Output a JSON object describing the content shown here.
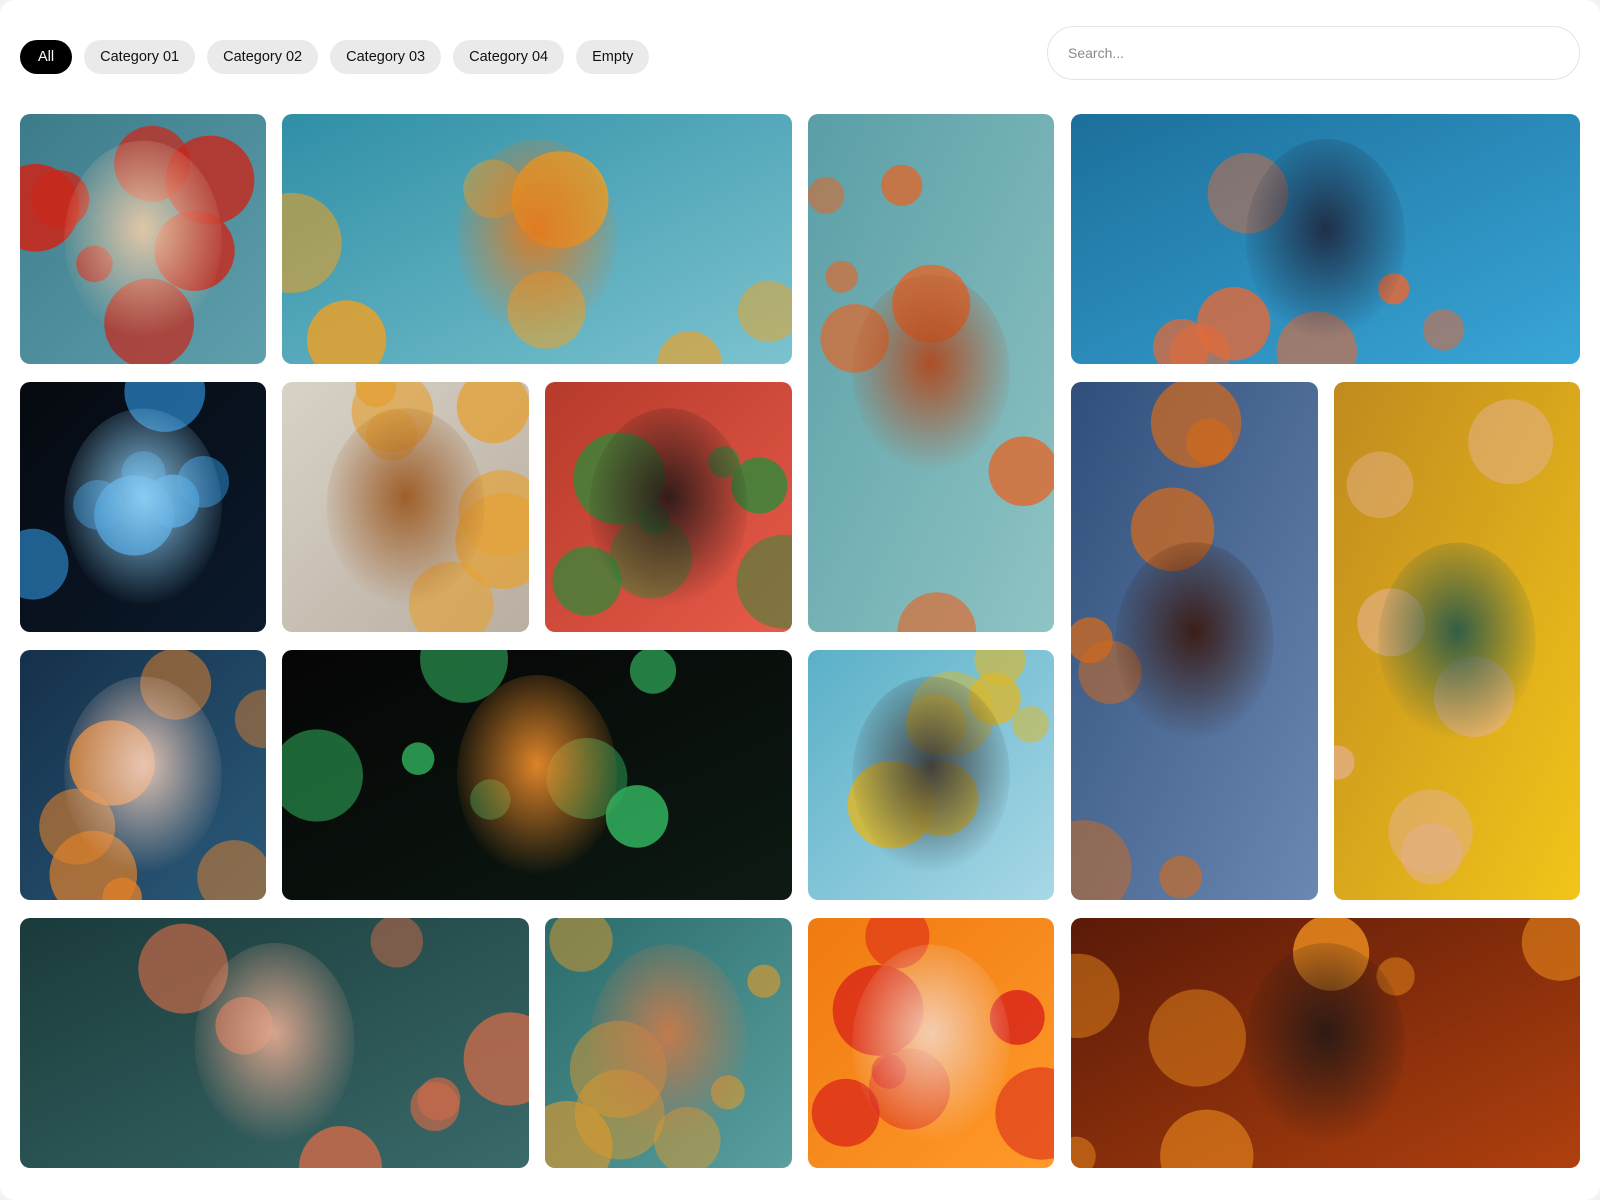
{
  "filters": {
    "items": [
      {
        "label": "All",
        "active": true
      },
      {
        "label": "Category 01",
        "active": false
      },
      {
        "label": "Category 02",
        "active": false
      },
      {
        "label": "Category 03",
        "active": false
      },
      {
        "label": "Category 04",
        "active": false
      },
      {
        "label": "Empty",
        "active": false
      }
    ]
  },
  "search": {
    "placeholder": "Search...",
    "value": ""
  },
  "gallery": {
    "images": [
      {
        "name": "portrait-red-cap-fish",
        "palette": [
          "#3d7b8a",
          "#5fa0ad",
          "#c8281c",
          "#e8c9a8"
        ]
      },
      {
        "name": "girl-underwater-oranges",
        "palette": [
          "#2f8fa6",
          "#7cc3cf",
          "#f0a020",
          "#e07a20"
        ]
      },
      {
        "name": "folk-doll-flower-crown",
        "palette": [
          "#5a9ea6",
          "#8fc4c4",
          "#e0672a",
          "#b04a20"
        ]
      },
      {
        "name": "vr-headset-explosion",
        "palette": [
          "#1c6f9a",
          "#39a6d8",
          "#e06a3a",
          "#1e2b44"
        ]
      },
      {
        "name": "cyber-girl-blue-glow",
        "palette": [
          "#06090f",
          "#0b1a2c",
          "#2a7fbf",
          "#8fd0f5"
        ]
      },
      {
        "name": "steampunk-goggles-pilot",
        "palette": [
          "#d8d2c8",
          "#b9aea0",
          "#e3a23a",
          "#9c5a22"
        ]
      },
      {
        "name": "woman-with-parrot",
        "palette": [
          "#b63a2a",
          "#e85b4a",
          "#2f8a3a",
          "#2a1a18"
        ]
      },
      {
        "name": "glass-cube-city-lava",
        "palette": [
          "#2f4f7a",
          "#6b88b2",
          "#d26a1c",
          "#3a1a12"
        ]
      },
      {
        "name": "flower-crown-yellow-portrait",
        "palette": [
          "#c08a1e",
          "#f2c51a",
          "#e3b08a",
          "#2a5a48"
        ]
      },
      {
        "name": "flower-wreath-doll-portrait",
        "palette": [
          "#15304a",
          "#2a5a7a",
          "#e0802a",
          "#eac9b8"
        ]
      },
      {
        "name": "neon-particle-runner",
        "palette": [
          "#050505",
          "#0d1a12",
          "#2fa85a",
          "#e88a2a"
        ]
      },
      {
        "name": "mechanical-bee-city",
        "palette": [
          "#5ab0c8",
          "#a8d8e6",
          "#d8b830",
          "#3a3a3a"
        ]
      },
      {
        "name": "crab-girl-portrait",
        "palette": [
          "#1a3a3a",
          "#3a6a6a",
          "#c86a4a",
          "#e0a890"
        ]
      },
      {
        "name": "big-eyed-creature-doll",
        "palette": [
          "#2a6a6a",
          "#5aa0a0",
          "#e09a2a",
          "#c87a4a"
        ]
      },
      {
        "name": "smiling-woman-oranges",
        "palette": [
          "#f07a10",
          "#ff9a2a",
          "#d8201a",
          "#f4d0b8"
        ]
      },
      {
        "name": "painted-face-bokeh",
        "palette": [
          "#5a1a08",
          "#b0400e",
          "#f0901e",
          "#2a1a14"
        ]
      }
    ]
  }
}
